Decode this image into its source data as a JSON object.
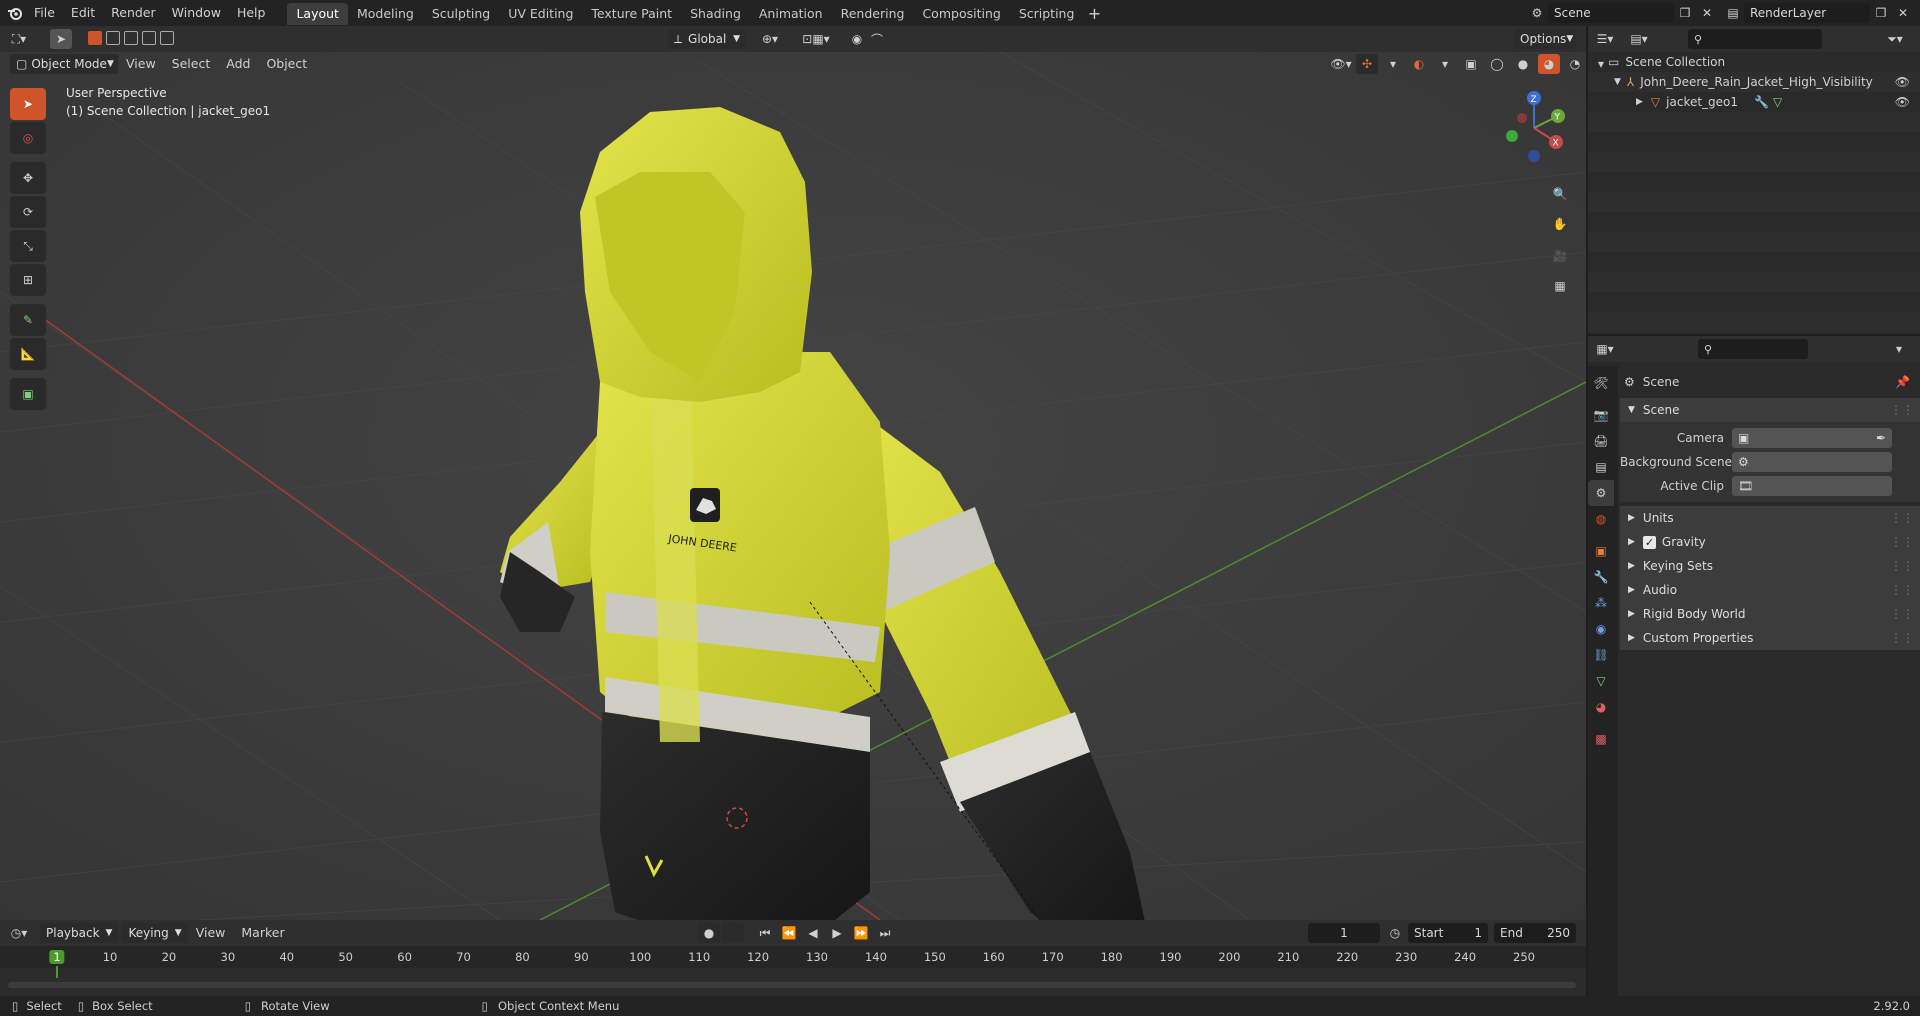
{
  "topbar": {
    "menus": [
      "File",
      "Edit",
      "Render",
      "Window",
      "Help"
    ],
    "workspaces": [
      "Layout",
      "Modeling",
      "Sculpting",
      "UV Editing",
      "Texture Paint",
      "Shading",
      "Animation",
      "Rendering",
      "Compositing",
      "Scripting"
    ],
    "active_workspace": "Layout",
    "scene_name": "Scene",
    "view_layer": "RenderLayer"
  },
  "viewport": {
    "mode": "Object Mode",
    "menus": [
      "View",
      "Select",
      "Add",
      "Object"
    ],
    "transform_orientation": "Global",
    "options_label": "Options",
    "view_name": "User Perspective",
    "collection_info": "(1) Scene Collection | jacket_geo1",
    "logo_text": "JOHN DEERE"
  },
  "timeline": {
    "menus": [
      "Playback",
      "Keying",
      "View",
      "Marker"
    ],
    "current_frame": "1",
    "start_label": "Start",
    "start": "1",
    "end_label": "End",
    "end": "250",
    "ruler": [
      "1",
      "10",
      "20",
      "30",
      "40",
      "50",
      "60",
      "70",
      "80",
      "90",
      "100",
      "110",
      "120",
      "130",
      "140",
      "150",
      "160",
      "170",
      "180",
      "190",
      "200",
      "210",
      "220",
      "230",
      "240",
      "250"
    ]
  },
  "outliner": {
    "root": "Scene Collection",
    "items": [
      {
        "name": "John_Deere_Rain_Jacket_High_Visibility"
      },
      {
        "name": "jacket_geo1"
      }
    ]
  },
  "properties": {
    "context": "Scene",
    "panel_title": "Scene",
    "fields": [
      {
        "label": "Camera"
      },
      {
        "label": "Background Scene"
      },
      {
        "label": "Active Clip"
      }
    ],
    "subpanels": [
      "Units",
      "Gravity",
      "Keying Sets",
      "Audio",
      "Rigid Body World",
      "Custom Properties"
    ],
    "gravity_checked": true
  },
  "statusbar": {
    "select": "Select",
    "box_select": "Box Select",
    "rotate_view": "Rotate View",
    "context_menu": "Object Context Menu",
    "version": "2.92.0"
  },
  "colors": {
    "accent": "#d0542a",
    "jacket_yellow": "#d9db2e",
    "reflective": "#c9c9c0",
    "dark": "#222222",
    "frame_marker": "#4c9a2a"
  }
}
